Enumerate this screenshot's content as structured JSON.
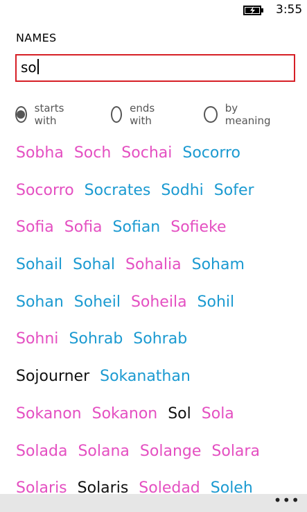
{
  "status": {
    "time": "3:55",
    "battery_icon": "battery-charging-icon"
  },
  "header": {
    "label": "NAMES"
  },
  "search": {
    "value": "so"
  },
  "filters": [
    {
      "label": "starts with",
      "selected": true
    },
    {
      "label": "ends with",
      "selected": false
    },
    {
      "label": "by meaning",
      "selected": false
    }
  ],
  "colors": {
    "pink": "#e44fc1",
    "blue": "#1b9ad1",
    "black": "#111111",
    "accent": "#d61f26"
  },
  "rows": [
    [
      {
        "name": "Sobha",
        "color": "pink"
      },
      {
        "name": "Soch",
        "color": "pink"
      },
      {
        "name": "Sochai",
        "color": "pink"
      },
      {
        "name": "Socorro",
        "color": "blue"
      }
    ],
    [
      {
        "name": "Socorro",
        "color": "pink"
      },
      {
        "name": "Socrates",
        "color": "blue"
      },
      {
        "name": "Sodhi",
        "color": "blue"
      },
      {
        "name": "Sofer",
        "color": "blue"
      }
    ],
    [
      {
        "name": "Sofia",
        "color": "pink"
      },
      {
        "name": "Sofia",
        "color": "pink"
      },
      {
        "name": "Sofian",
        "color": "blue"
      },
      {
        "name": "Sofieke",
        "color": "pink"
      }
    ],
    [
      {
        "name": "Sohail",
        "color": "blue"
      },
      {
        "name": "Sohal",
        "color": "blue"
      },
      {
        "name": "Sohalia",
        "color": "pink"
      },
      {
        "name": "Soham",
        "color": "blue"
      }
    ],
    [
      {
        "name": "Sohan",
        "color": "blue"
      },
      {
        "name": "Soheil",
        "color": "blue"
      },
      {
        "name": "Soheila",
        "color": "pink"
      },
      {
        "name": "Sohil",
        "color": "blue"
      }
    ],
    [
      {
        "name": "Sohni",
        "color": "pink"
      },
      {
        "name": "Sohrab",
        "color": "blue"
      },
      {
        "name": "Sohrab",
        "color": "blue"
      }
    ],
    [
      {
        "name": "Sojourner",
        "color": "black"
      },
      {
        "name": "Sokanathan",
        "color": "blue"
      }
    ],
    [
      {
        "name": "Sokanon",
        "color": "pink"
      },
      {
        "name": "Sokanon",
        "color": "pink"
      },
      {
        "name": "Sol",
        "color": "black"
      },
      {
        "name": "Sola",
        "color": "pink"
      }
    ],
    [
      {
        "name": "Solada",
        "color": "pink"
      },
      {
        "name": "Solana",
        "color": "pink"
      },
      {
        "name": "Solange",
        "color": "pink"
      },
      {
        "name": "Solara",
        "color": "pink"
      }
    ],
    [
      {
        "name": "Solaris",
        "color": "pink"
      },
      {
        "name": "Solaris",
        "color": "black"
      },
      {
        "name": "Soledad",
        "color": "pink"
      },
      {
        "name": "Soleh",
        "color": "blue"
      }
    ]
  ],
  "appbar": {
    "more_label": "•••"
  }
}
